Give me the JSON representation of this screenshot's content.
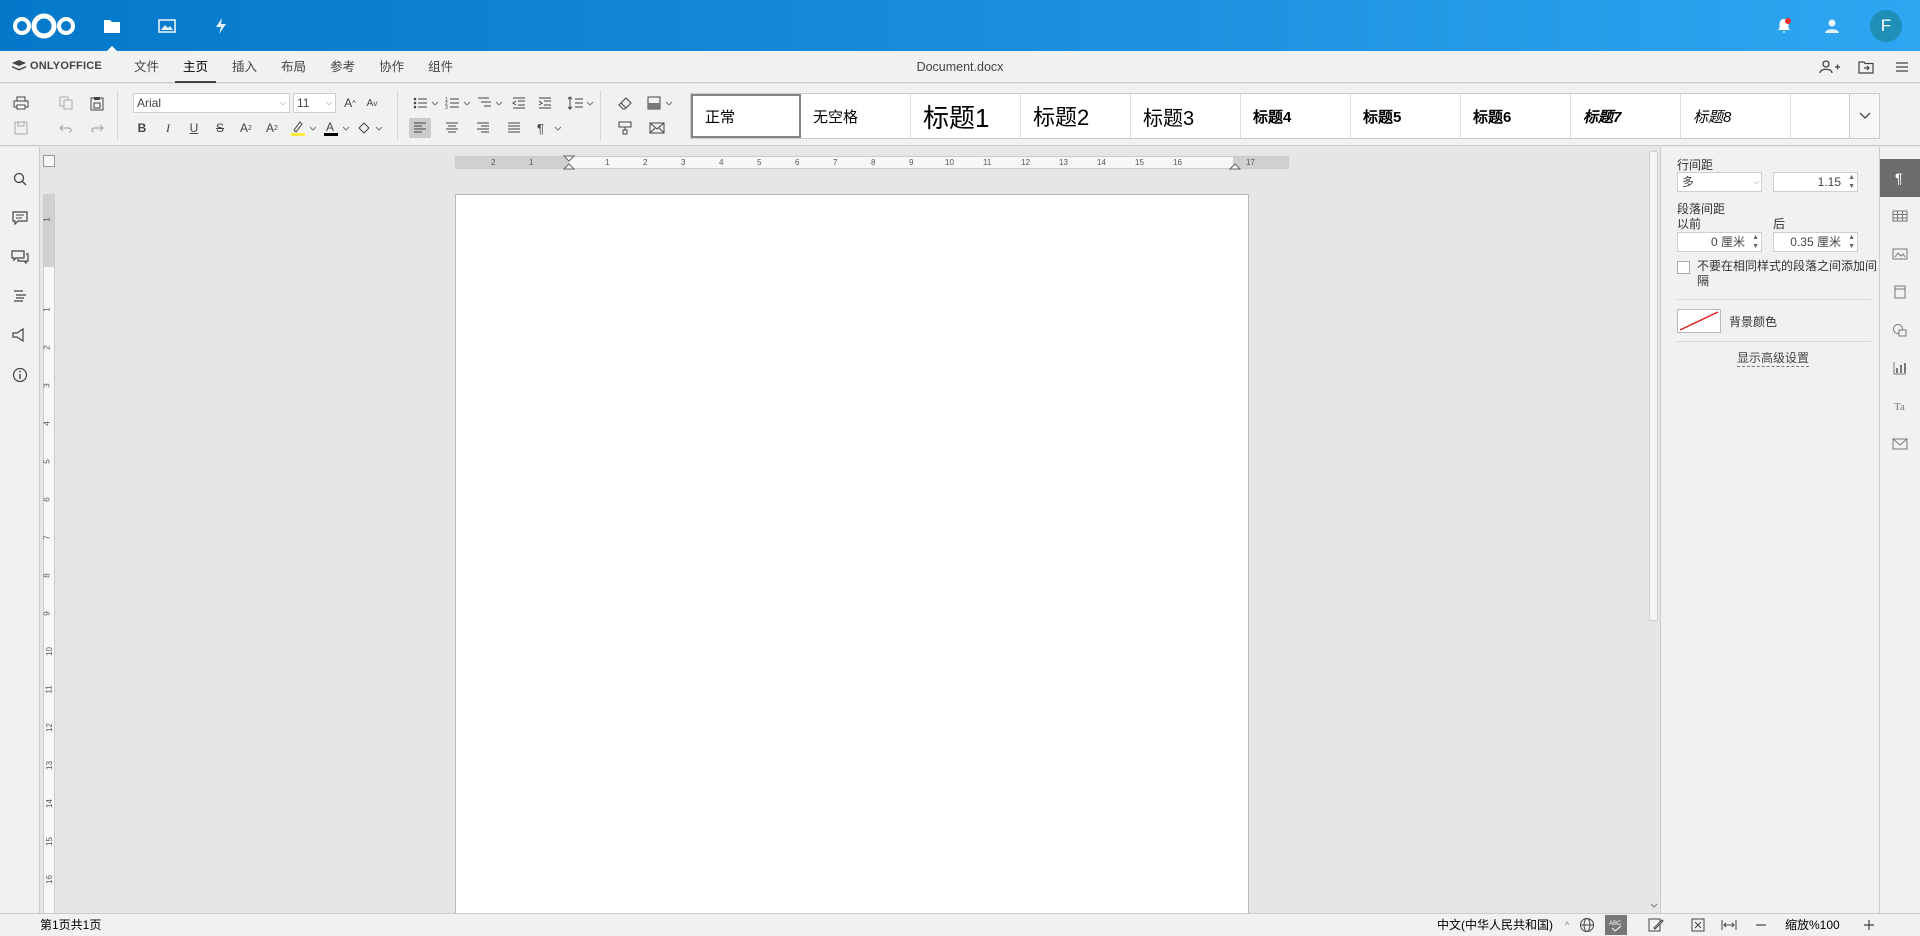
{
  "nextcloud": {
    "apps": [
      {
        "name": "files",
        "icon": "folder-icon"
      },
      {
        "name": "photos",
        "icon": "image-icon"
      },
      {
        "name": "activity",
        "icon": "lightning-icon"
      }
    ],
    "avatar_initial": "F"
  },
  "editor": {
    "brand": "ONLYOFFICE",
    "menu_tabs": [
      "文件",
      "主页",
      "插入",
      "布局",
      "参考",
      "协作",
      "组件"
    ],
    "active_tab": "主页",
    "doc_title": "Document.docx"
  },
  "toolbar": {
    "font_name": "Arial",
    "font_size": "11",
    "styles": [
      "正常",
      "无空格",
      "标题1",
      "标题2",
      "标题3",
      "标题4",
      "标题5",
      "标题6",
      "标题7",
      "标题8"
    ],
    "active_style": "正常"
  },
  "ruler": {
    "h_ticks": [
      "2",
      "1",
      "1",
      "2",
      "3",
      "4",
      "5",
      "6",
      "7",
      "8",
      "9",
      "10",
      "11",
      "12",
      "13",
      "14",
      "15",
      "16",
      "17"
    ],
    "v_ticks": [
      "1",
      "1",
      "2",
      "3",
      "4",
      "5",
      "6",
      "7",
      "8",
      "9",
      "10",
      "11",
      "12",
      "13",
      "14",
      "15",
      "16"
    ]
  },
  "right_panel": {
    "line_spacing_label": "行间距",
    "line_spacing_mode": "多",
    "line_spacing_value": "1.15",
    "para_spacing_label": "段落间距",
    "before_label": "以前",
    "before_value": "0 厘米",
    "after_label": "后",
    "after_value": "0.35 厘米",
    "no_space_same_style": "不要在相同样式的段落之间添加间隔",
    "bg_color_label": "背景颜色",
    "advanced_link": "显示高级设置"
  },
  "statusbar": {
    "page_info": "第1页共1页",
    "language": "中文(中华人民共和国)",
    "zoom": "缩放%100"
  },
  "colors": {
    "header_start": "#0478c9",
    "header_end": "#2ea6f2",
    "notification_dot": "#e9322d",
    "bg_swatch_line": "#e02020"
  }
}
